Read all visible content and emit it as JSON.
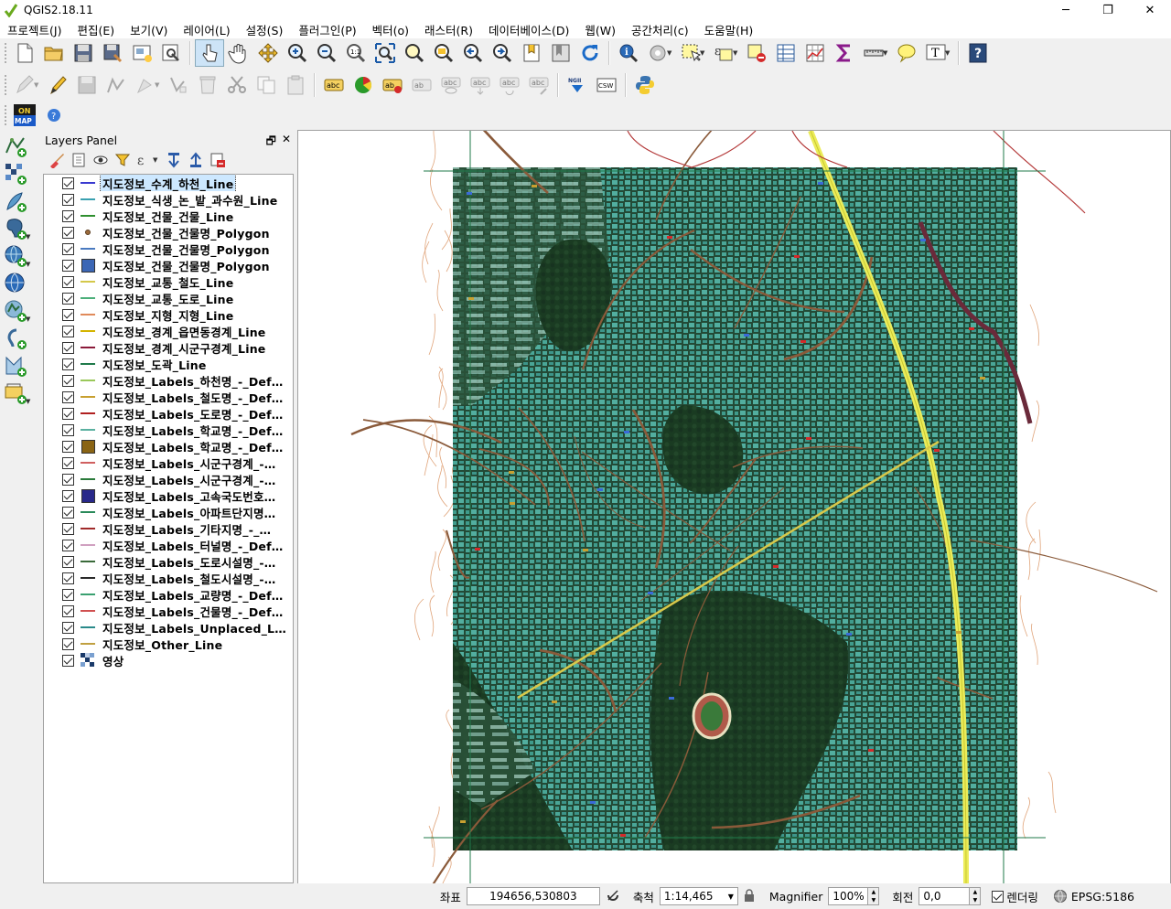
{
  "window": {
    "title": "QGIS2.18.11",
    "minimize": "─",
    "restore": "❐",
    "close": "✕"
  },
  "menu": [
    "프로젝트(J)",
    "편집(E)",
    "보기(V)",
    "레이어(L)",
    "설정(S)",
    "플러그인(P)",
    "벡터(o)",
    "래스터(R)",
    "데이터베이스(D)",
    "웹(W)",
    "공간처리(c)",
    "도움말(H)"
  ],
  "toolbar_icons": {
    "row1": [
      "new-project-icon",
      "open-project-icon",
      "save-project-icon",
      "save-as-icon",
      "new-print-composer-icon",
      "print-composer-manager-icon",
      "touch-zoom-icon",
      "pan-icon",
      "pan-to-selection-icon",
      "zoom-in-icon",
      "zoom-out-icon",
      "zoom-actual-size-icon",
      "zoom-full-icon",
      "zoom-to-selection-icon",
      "zoom-to-layer-icon",
      "zoom-last-icon",
      "zoom-next-icon",
      "new-bookmark-icon",
      "show-bookmarks-icon",
      "refresh-icon",
      "identify-icon",
      "run-feature-action-icon",
      "select-features-icon",
      "select-by-expression-icon",
      "deselect-all-icon",
      "open-attribute-table-icon",
      "statistical-summary-icon",
      "field-calculator-icon",
      "measure-icon",
      "map-tips-icon",
      "text-annotation-icon",
      "help-icon"
    ],
    "row2": [
      "current-edits-icon",
      "toggle-editing-icon",
      "save-edits-icon",
      "add-feature-icon",
      "move-feature-icon",
      "node-tool-icon",
      "delete-selected-icon",
      "cut-features-icon",
      "copy-features-icon",
      "paste-features-icon",
      "layer-labeling-icon",
      "layer-diagram-icon",
      "pin-labels-icon",
      "highlight-pinned-labels-icon",
      "show-hide-labels-icon",
      "move-label-icon",
      "rotate-label-icon",
      "change-label-icon",
      "ngii-icon",
      "csw-icon",
      "python-console-icon"
    ],
    "row3": [
      "onmap-icon",
      "onmap-help-icon"
    ],
    "left": [
      "add-vector-layer-icon",
      "add-raster-layer-icon",
      "add-spatialite-layer-icon",
      "add-postgis-layer-icon",
      "add-wms-layer-icon",
      "add-wfs-layer-icon",
      "add-wcs-layer-icon",
      "add-delimited-text-icon",
      "add-virtual-layer-icon",
      "new-shapefile-layer-icon"
    ]
  },
  "toolbar_labels": {
    "csw": "CSW",
    "ngii": "NGII",
    "onmap_on": "ON",
    "onmap_map": "MAP",
    "abc": "abc",
    "text_T": "T",
    "help": "?"
  },
  "layers_panel": {
    "title": "Layers Panel",
    "float_btn": "🗗",
    "close_btn": "✕",
    "tool_icons": [
      "style-manager-icon",
      "add-group-icon",
      "manage-visibility-icon",
      "filter-legend-icon",
      "filter-by-expression-icon",
      "expand-all-icon",
      "collapse-all-icon",
      "remove-layer-icon"
    ],
    "layers": [
      {
        "name": "지도정보_수계_하천_Line",
        "symbol": "line",
        "color": "#3a3ad0",
        "checked": true,
        "selected": true
      },
      {
        "name": "지도정보_식생_논_밭_과수원_Line",
        "symbol": "line",
        "color": "#3aa0b0",
        "checked": true
      },
      {
        "name": "지도정보_건물_건물_Line",
        "symbol": "line",
        "color": "#2f8f2f",
        "checked": true
      },
      {
        "name": "지도정보_건물_건물명_Polygon",
        "symbol": "dot",
        "color": "#9c6b3c",
        "checked": true
      },
      {
        "name": "지도정보_건물_건물명_Polygon",
        "symbol": "line",
        "color": "#4a7ac0",
        "checked": true
      },
      {
        "name": "지도정보_건물_건물명_Polygon",
        "symbol": "fill",
        "color": "#3b66b5",
        "checked": true
      },
      {
        "name": "지도정보_교통_철도_Line",
        "symbol": "line",
        "color": "#d4c84a",
        "checked": true
      },
      {
        "name": "지도정보_교통_도로_Line",
        "symbol": "line",
        "color": "#4caf7a",
        "checked": true
      },
      {
        "name": "지도정보_지형_지형_Line",
        "symbol": "line",
        "color": "#e08a5a",
        "checked": true
      },
      {
        "name": "지도정보_경계_읍면동경계_Line",
        "symbol": "line",
        "color": "#d4b400",
        "checked": true
      },
      {
        "name": "지도정보_경계_시군구경계_Line",
        "symbol": "line",
        "color": "#8b1a3a",
        "checked": true
      },
      {
        "name": "지도정보_도곽_Line",
        "symbol": "line",
        "color": "#1f7a4a",
        "checked": true
      },
      {
        "name": "지도정보_Labels_하천명_-_Def…",
        "symbol": "line",
        "color": "#9ac85a",
        "checked": true
      },
      {
        "name": "지도정보_Labels_철도명_-_Def…",
        "symbol": "line",
        "color": "#c8a030",
        "checked": true
      },
      {
        "name": "지도정보_Labels_도로명_-_Def…",
        "symbol": "line",
        "color": "#b02020",
        "checked": true
      },
      {
        "name": "지도정보_Labels_학교명_-_Def…",
        "symbol": "line",
        "color": "#5ab0a0",
        "checked": true
      },
      {
        "name": "지도정보_Labels_학교명_-_Def…",
        "symbol": "fill",
        "color": "#8a6414",
        "checked": true
      },
      {
        "name": "지도정보_Labels_시군구경계_-…",
        "symbol": "line",
        "color": "#d06060",
        "checked": true
      },
      {
        "name": "지도정보_Labels_시군구경계_-…",
        "symbol": "line",
        "color": "#2a7a3a",
        "checked": true
      },
      {
        "name": "지도정보_Labels_고속국도번호…",
        "symbol": "fill",
        "color": "#28288a",
        "checked": true
      },
      {
        "name": "지도정보_Labels_아파트단지명…",
        "symbol": "line",
        "color": "#2a8a5a",
        "checked": true
      },
      {
        "name": "지도정보_Labels_기타지명_-_…",
        "symbol": "line",
        "color": "#a02a2a",
        "checked": true
      },
      {
        "name": "지도정보_Labels_터널명_-_Def…",
        "symbol": "line",
        "color": "#d0a0c0",
        "checked": true
      },
      {
        "name": "지도정보_Labels_도로시설명_-…",
        "symbol": "line",
        "color": "#3a6a3a",
        "checked": true
      },
      {
        "name": "지도정보_Labels_철도시설명_-…",
        "symbol": "line",
        "color": "#2a2a2a",
        "checked": true
      },
      {
        "name": "지도정보_Labels_교량명_-_Def…",
        "symbol": "line",
        "color": "#3aa070",
        "checked": true
      },
      {
        "name": "지도정보_Labels_건물명_-_Def…",
        "symbol": "line",
        "color": "#d05050",
        "checked": true
      },
      {
        "name": "지도정보_Labels_Unplaced_L…",
        "symbol": "line",
        "color": "#2a8a8a",
        "checked": true
      },
      {
        "name": "지도정보_Other_Line",
        "symbol": "line",
        "color": "#c0a040",
        "checked": true
      },
      {
        "name": "영상",
        "symbol": "raster",
        "color": "#1a3a6a",
        "checked": true
      }
    ]
  },
  "status": {
    "coord_label": "좌표",
    "coord_value": "194656,530803",
    "scale_label": "축척",
    "scale_value": "1:14,465",
    "magnifier_label": "Magnifier",
    "magnifier_value": "100%",
    "rotation_label": "회전",
    "rotation_value": "0,0",
    "render_label": "렌더링",
    "crs": "EPSG:5186"
  },
  "colors": {
    "imagery_dark": "#1d3d2a",
    "building_teal": "#3a9a8a",
    "road_brown": "#8a5a3a",
    "highway_yellow": "#e6e65a",
    "boundary_red": "#b43a3a"
  }
}
